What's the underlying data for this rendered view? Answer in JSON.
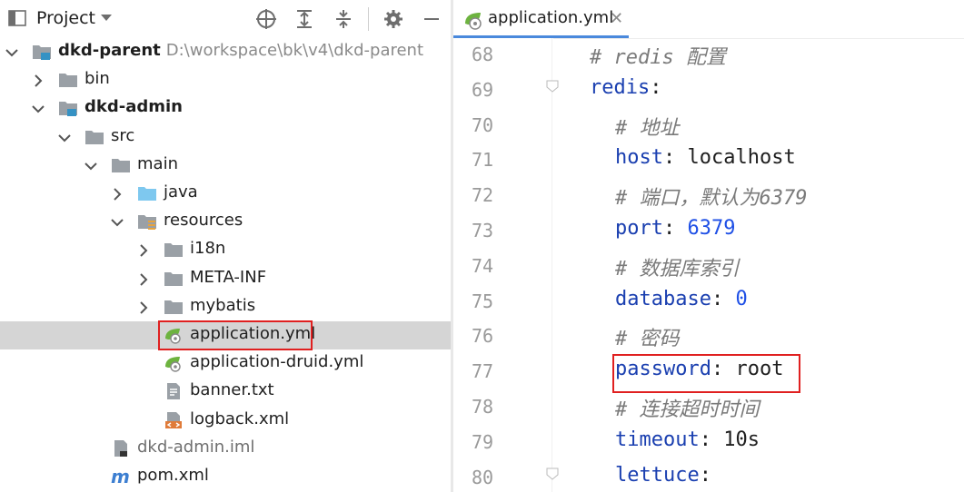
{
  "project_panel": {
    "title": "Project",
    "toolbar_icons": [
      "locate-icon",
      "expand-all-icon",
      "collapse-all-icon",
      "gear-icon",
      "minimize-icon"
    ]
  },
  "tree": [
    {
      "label": "dkd-parent",
      "path": "D:\\workspace\\bk\\v4\\dkd-parent",
      "icon": "module-folder",
      "bold": true,
      "arrow": "down",
      "depth": 0
    },
    {
      "label": "bin",
      "icon": "folder",
      "arrow": "right",
      "depth": 1
    },
    {
      "label": "dkd-admin",
      "icon": "module-folder",
      "bold": true,
      "arrow": "down",
      "depth": 1
    },
    {
      "label": "src",
      "icon": "folder",
      "arrow": "down",
      "depth": 2
    },
    {
      "label": "main",
      "icon": "folder",
      "arrow": "down",
      "depth": 3
    },
    {
      "label": "java",
      "icon": "source-folder",
      "arrow": "right",
      "depth": 4
    },
    {
      "label": "resources",
      "icon": "resources-folder",
      "arrow": "down",
      "depth": 4
    },
    {
      "label": "i18n",
      "icon": "folder",
      "arrow": "right",
      "depth": 5
    },
    {
      "label": "META-INF",
      "icon": "folder",
      "arrow": "right",
      "depth": 5
    },
    {
      "label": "mybatis",
      "icon": "folder",
      "arrow": "right",
      "depth": 5
    },
    {
      "label": "application.yml",
      "icon": "spring-yml",
      "selected": true,
      "depth": 5
    },
    {
      "label": "application-druid.yml",
      "icon": "spring-yml",
      "depth": 5
    },
    {
      "label": "banner.txt",
      "icon": "text-file",
      "depth": 5
    },
    {
      "label": "logback.xml",
      "icon": "xml-file",
      "depth": 5
    },
    {
      "label": "dkd-admin.iml",
      "icon": "iml-file",
      "gray": true,
      "depth": 3
    },
    {
      "label": "pom.xml",
      "icon": "maven-file",
      "depth": 3
    }
  ],
  "editor": {
    "tab_label": "application.yml",
    "tab_close": "✕",
    "lines": [
      {
        "num": "68",
        "indent": 0,
        "comment": "# redis 配置"
      },
      {
        "num": "69",
        "indent": 0,
        "key": "redis",
        "value": ""
      },
      {
        "num": "70",
        "indent": 1,
        "comment": "# 地址"
      },
      {
        "num": "71",
        "indent": 1,
        "key": "host",
        "value": "localhost"
      },
      {
        "num": "72",
        "indent": 1,
        "comment": "# 端口，默认为6379"
      },
      {
        "num": "73",
        "indent": 1,
        "key": "port",
        "value": "6379",
        "value_type": "number"
      },
      {
        "num": "74",
        "indent": 1,
        "comment": "# 数据库索引"
      },
      {
        "num": "75",
        "indent": 1,
        "key": "database",
        "value": "0",
        "value_type": "number"
      },
      {
        "num": "76",
        "indent": 1,
        "comment": "# 密码"
      },
      {
        "num": "77",
        "indent": 1,
        "key": "password",
        "value": "root",
        "highlight": true
      },
      {
        "num": "78",
        "indent": 1,
        "comment": "# 连接超时时间"
      },
      {
        "num": "79",
        "indent": 1,
        "key": "timeout",
        "value": "10s"
      },
      {
        "num": "80",
        "indent": 1,
        "key": "lettuce",
        "value": ""
      }
    ]
  },
  "colors": {
    "selection": "#d5d5d5",
    "highlight_box": "#e02020",
    "yaml_key": "#1a3fb0",
    "number": "#1f50e6",
    "comment": "#7a7a7a"
  }
}
